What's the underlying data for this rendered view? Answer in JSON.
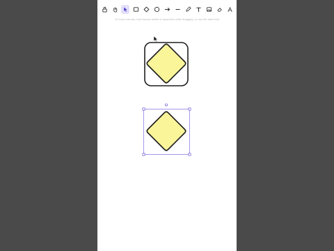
{
  "toolbar": {
    "tools": [
      {
        "icon": "lock-icon",
        "active": false
      },
      {
        "icon": "hand-icon",
        "active": false
      },
      {
        "icon": "selection-icon",
        "active": true
      },
      {
        "icon": "rectangle-icon",
        "active": false
      },
      {
        "icon": "diamond-icon",
        "active": false
      },
      {
        "icon": "ellipse-icon",
        "active": false
      },
      {
        "icon": "arrow-icon",
        "active": false
      },
      {
        "icon": "line-icon",
        "active": false
      },
      {
        "icon": "pencil-icon",
        "active": false
      },
      {
        "icon": "text-icon",
        "active": false
      },
      {
        "icon": "image-icon",
        "active": false
      },
      {
        "icon": "eraser-icon",
        "active": false
      },
      {
        "icon": "library-icon",
        "active": false
      }
    ]
  },
  "hint": {
    "text": "To move canvas, hold mouse wheel or spacebar while dragging, or use the hand tool"
  },
  "colors": {
    "background_app": "#4a4a4a",
    "canvas": "#ffffff",
    "shape_fill": "#fbf59a",
    "stroke": "#1e1e1e",
    "selection": "#7d6ee0",
    "active_tool": "#e4e0fb"
  }
}
